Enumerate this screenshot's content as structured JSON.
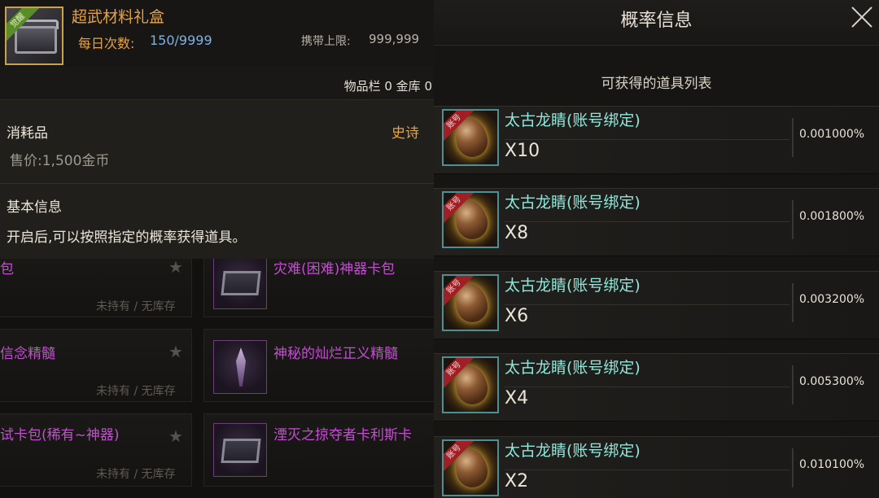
{
  "item": {
    "badge": "觉醒",
    "name": "超武材料礼盒",
    "daily_label": "每日次数:",
    "daily_value": "150/9999",
    "carry_label": "携带上限:",
    "carry_value": "999,999",
    "storage_text": "物品栏 0 金库 0",
    "type": "消耗品",
    "rarity": "史诗",
    "price": "售价:1,500金币",
    "basic_info_title": "基本信息",
    "basic_info_desc": "开启后,可以按照指定的概率获得道具。"
  },
  "background_list": {
    "rows": [
      {
        "left_name": "包",
        "right_name": "灾难(困难)神器卡包",
        "left_stock": "未持有 / 无库存"
      },
      {
        "left_name": "信念精髓",
        "right_name": "神秘的灿烂正义精髓",
        "left_stock": "未持有 / 无库存"
      },
      {
        "left_name": "试卡包(稀有~神器)",
        "right_name": "湮灭之掠夺者卡利斯卡",
        "left_stock": "未持有 / 无库存"
      }
    ]
  },
  "probability_panel": {
    "title": "概率信息",
    "list_title": "可获得的道具列表",
    "items": [
      {
        "tag": "账号",
        "name": "太古龙睛(账号绑定)",
        "quantity": "X10",
        "rate": "0.001000%"
      },
      {
        "tag": "账号",
        "name": "太古龙睛(账号绑定)",
        "quantity": "X8",
        "rate": "0.001800%"
      },
      {
        "tag": "账号",
        "name": "太古龙睛(账号绑定)",
        "quantity": "X6",
        "rate": "0.003200%"
      },
      {
        "tag": "账号",
        "name": "太古龙睛(账号绑定)",
        "quantity": "X4",
        "rate": "0.005300%"
      },
      {
        "tag": "账号",
        "name": "太古龙睛(账号绑定)",
        "quantity": "X2",
        "rate": "0.010100%"
      }
    ]
  },
  "colors": {
    "item_name": "#e8a33c",
    "rarity_epic": "#e8a33c",
    "bound_item_name": "#8fe6d8",
    "background_item_name": "#c24fd0"
  },
  "icons": {
    "item": "chest-icon",
    "probability_item": "dragon-eye-egg-icon",
    "close": "close-icon",
    "favorite": "star-icon"
  }
}
